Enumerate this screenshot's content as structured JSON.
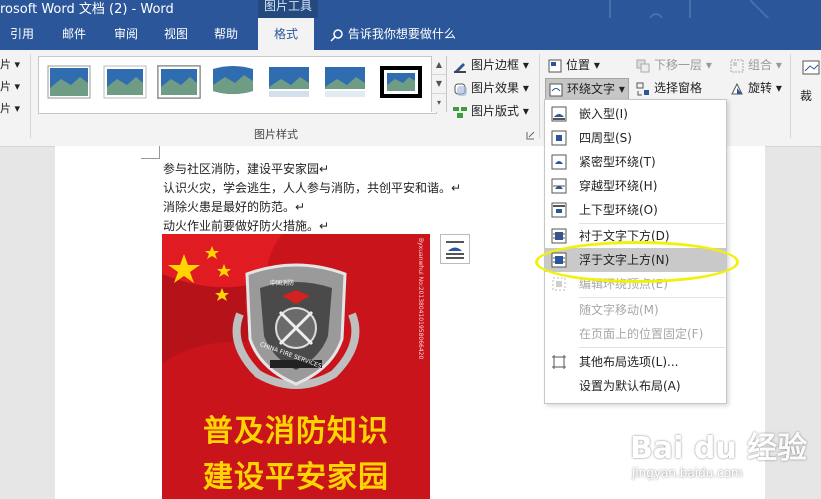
{
  "window": {
    "title": "rosoft Word 文档 (2)  -  Word",
    "context_tab": "图片工具"
  },
  "tabs": [
    {
      "label": "引用"
    },
    {
      "label": "邮件"
    },
    {
      "label": "审阅"
    },
    {
      "label": "视图"
    },
    {
      "label": "帮助"
    },
    {
      "label": "格式",
      "active": true
    }
  ],
  "tell_me": "告诉我你想要做什么",
  "left_edge": [
    "片 ▾",
    "片 ▾",
    "片 ▾"
  ],
  "ribbon": {
    "styles_group_label": "图片样式",
    "picture_border": "图片边框",
    "picture_effects": "图片效果",
    "picture_layout": "图片版式",
    "position": "位置",
    "wrap_text": "环绕文字",
    "send_backward": "下移一层",
    "selection_pane": "选择窗格",
    "group": "组合",
    "rotate": "旋转",
    "crop_partial": "裁"
  },
  "document": {
    "lines": [
      "参与社区消防，建设平安家园↵",
      "认识火灾，学会逃生，人人参与消防，共创平安和谐。↵",
      "消除火患是最好的防范。↵",
      "动火作业前要做好防火措施。↵"
    ],
    "poster": {
      "slogan_1": "普及消防知识",
      "slogan_2": "建设平安家园",
      "badge_cn": "中国消防",
      "badge_en": "CHINA FIRE SERVICES",
      "side_text": "Byxuanwhui No:2013804101958066420"
    }
  },
  "wrap_menu": {
    "items": [
      {
        "label": "嵌入型(I)",
        "enabled": true,
        "icon": "wrap-inline-icon"
      },
      {
        "label": "四周型(S)",
        "enabled": true,
        "icon": "wrap-square-icon"
      },
      {
        "label": "紧密型环绕(T)",
        "enabled": true,
        "icon": "wrap-tight-icon"
      },
      {
        "label": "穿越型环绕(H)",
        "enabled": true,
        "icon": "wrap-through-icon"
      },
      {
        "label": "上下型环绕(O)",
        "enabled": true,
        "icon": "wrap-topbottom-icon"
      },
      {
        "label": "衬于文字下方(D)",
        "enabled": true,
        "icon": "wrap-behind-icon"
      },
      {
        "label": "浮于文字上方(N)",
        "enabled": true,
        "highlighted": true,
        "icon": "wrap-front-icon"
      },
      {
        "label": "编辑环绕顶点(E)",
        "enabled": false,
        "icon": "edit-wrap-points-icon"
      },
      {
        "label": "随文字移动(M)",
        "enabled": false
      },
      {
        "label": "在页面上的位置固定(F)",
        "enabled": false
      },
      {
        "label": "其他布局选项(L)...",
        "enabled": true,
        "icon": "layout-options-icon"
      },
      {
        "label": "设置为默认布局(A)",
        "enabled": true
      }
    ]
  },
  "watermark": {
    "brand": "Bai du 经验",
    "url": "jingyan.baidu.com"
  },
  "colors": {
    "ribbon_blue": "#2b579a",
    "highlight_circle": "#f1f10c",
    "poster_red": "#c9141b",
    "slogan_yellow": "#ffd400"
  }
}
